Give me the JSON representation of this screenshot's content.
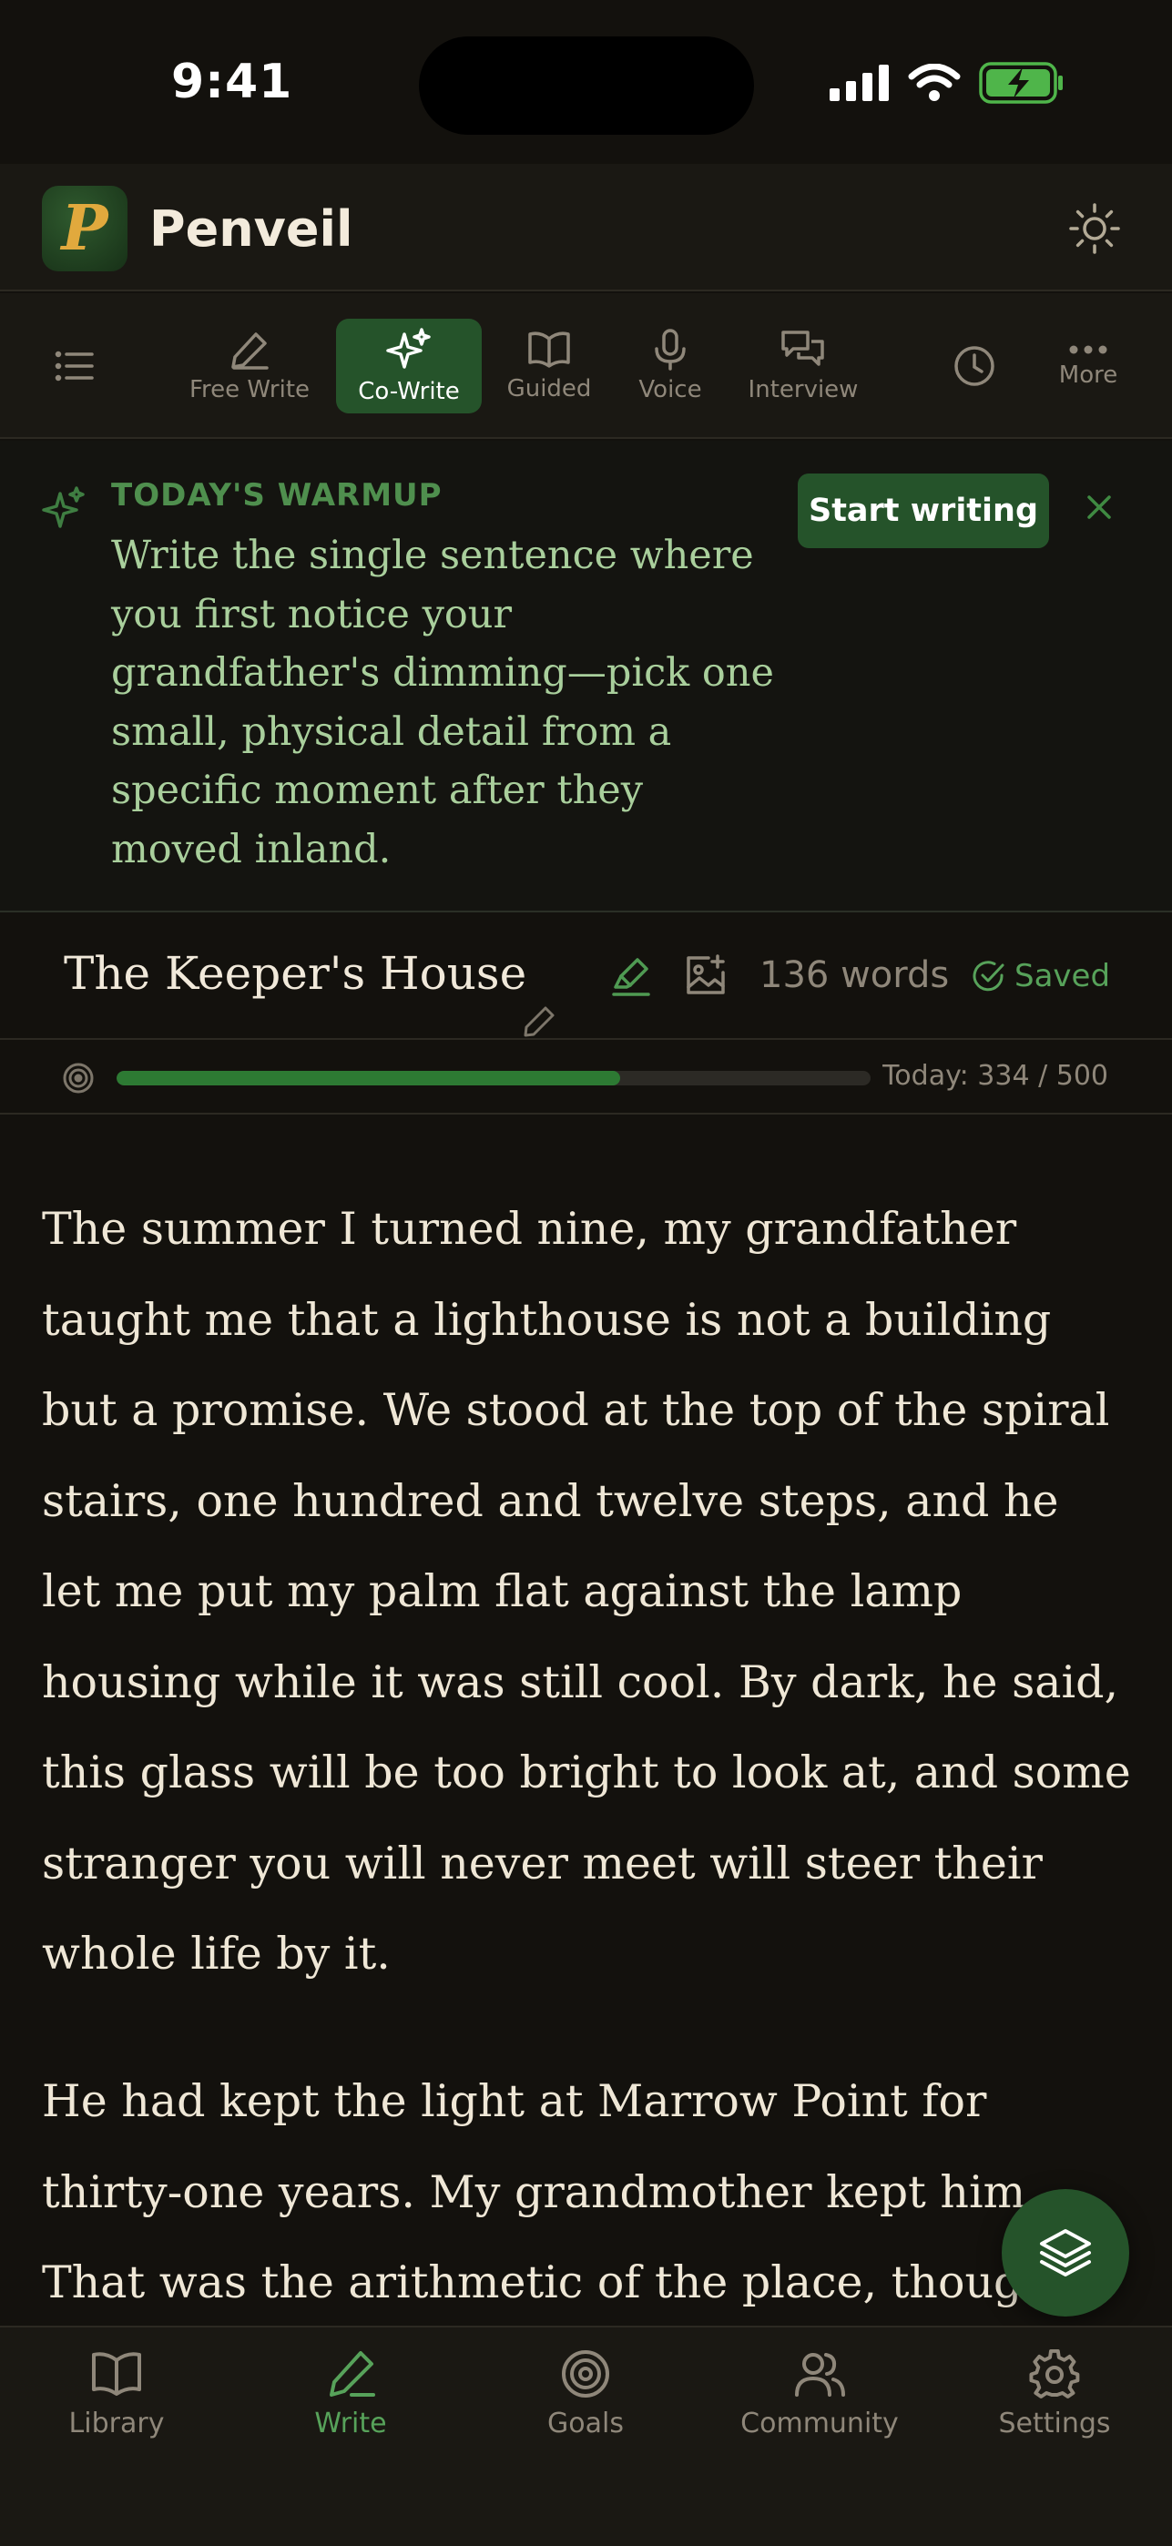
{
  "status_bar": {
    "time": "9:41"
  },
  "header": {
    "app_name": "Penveil",
    "logo_letter": "P",
    "theme_icon": "sun-icon"
  },
  "toolbar": {
    "outline_icon": "list-icon",
    "modes": [
      {
        "label": "Free Write",
        "icon": "pen-icon",
        "active": false
      },
      {
        "label": "Co-Write",
        "icon": "sparkles-icon",
        "active": true
      },
      {
        "label": "Guided",
        "icon": "book-open-icon",
        "active": false
      },
      {
        "label": "Voice",
        "icon": "microphone-icon",
        "active": false
      },
      {
        "label": "Interview",
        "icon": "chat-bubbles-icon",
        "active": false
      }
    ],
    "history_icon": "clock-icon",
    "more_label": "More"
  },
  "warmup": {
    "label": "TODAY'S WARMUP",
    "prompt": "Write the single sentence where you first notice your grandfather's dimming—pick one small, physical detail from a specific moment after they moved inland.",
    "start_label": "Start writing"
  },
  "document": {
    "title": "The Keeper's House",
    "word_count": "136 words",
    "saved_label": "Saved"
  },
  "progress": {
    "today": 334,
    "goal": 500,
    "text": "Today: 334 / 500"
  },
  "editor": {
    "paragraphs": [
      "The summer I turned nine, my grandfather taught me that a lighthouse is not a building but a promise. We stood at the top of the spiral stairs, one hundred and twelve steps, and he let me put my palm flat against the lamp housing while it was still cool. By dark, he said, this glass will be too bright to look at, and some stranger you will never meet will steer their whole life by it.",
      "He had kept the light at Marrow Point for thirty-one years. My grandmother kept him. That was the arithmetic of the place, though"
    ]
  },
  "nav": {
    "items": [
      {
        "label": "Library",
        "icon": "book-icon",
        "active": false
      },
      {
        "label": "Write",
        "icon": "pencil-icon",
        "active": true
      },
      {
        "label": "Goals",
        "icon": "target-icon",
        "active": false
      },
      {
        "label": "Community",
        "icon": "users-icon",
        "active": false
      },
      {
        "label": "Settings",
        "icon": "gear-icon",
        "active": false
      }
    ]
  },
  "colors": {
    "accent": "#25532a",
    "accent_text": "#57a25a",
    "background": "#13110d",
    "warmup_text": "#a9cf9c"
  }
}
